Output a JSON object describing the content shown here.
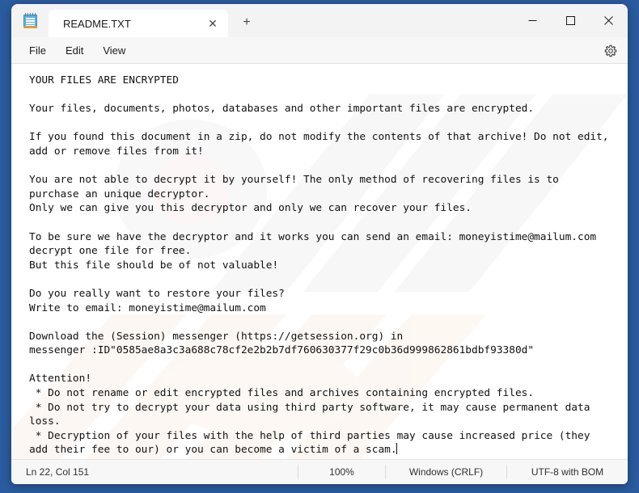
{
  "window": {
    "background_color": "#2a5b9e",
    "app_icon": "notepad-icon"
  },
  "titlebar": {
    "tab_title": "README.TXT",
    "tab_close_label": "✕",
    "new_tab_label": "+",
    "minimize_label": "–",
    "maximize_label": "☐",
    "close_label": "✕"
  },
  "menubar": {
    "items": [
      {
        "label": "File"
      },
      {
        "label": "Edit"
      },
      {
        "label": "View"
      }
    ],
    "settings_icon": "gear-icon"
  },
  "editor": {
    "content": "YOUR FILES ARE ENCRYPTED\n\nYour files, documents, photos, databases and other important files are encrypted.\n\nIf you found this document in a zip, do not modify the contents of that archive! Do not edit,\nadd or remove files from it!\n\nYou are not able to decrypt it by yourself! The only method of recovering files is to\npurchase an unique decryptor.\nOnly we can give you this decryptor and only we can recover your files.\n\nTo be sure we have the decryptor and it works you can send an email: moneyistime@mailum.com\ndecrypt one file for free.\nBut this file should be of not valuable!\n\nDo you really want to restore your files?\nWrite to email: moneyistime@mailum.com\n\nDownload the (Session) messenger (https://getsession.org) in\nmessenger :ID\"0585ae8a3c3a688c78cf2e2b2b7df760630377f29c0b36d999862861bdbf93380d\"\n\nAttention!\n * Do not rename or edit encrypted files and archives containing encrypted files.\n * Do not try to decrypt your data using third party software, it may cause permanent data\nloss.\n * Decryption of your files with the help of third parties may cause increased price (they\nadd their fee to our) or you can become a victim of a scam.",
    "contact_email": "moneyistime@mailum.com",
    "session_url": "https://getsession.org",
    "session_id": "0585ae8a3c3a688c78cf2e2b2b7df760630377f29c0b36d999862861bdbf93380d"
  },
  "statusbar": {
    "line_column": "Ln 22, Col 151",
    "zoom": "100%",
    "line_ending": "Windows (CRLF)",
    "encoding": "UTF-8 with BOM"
  }
}
